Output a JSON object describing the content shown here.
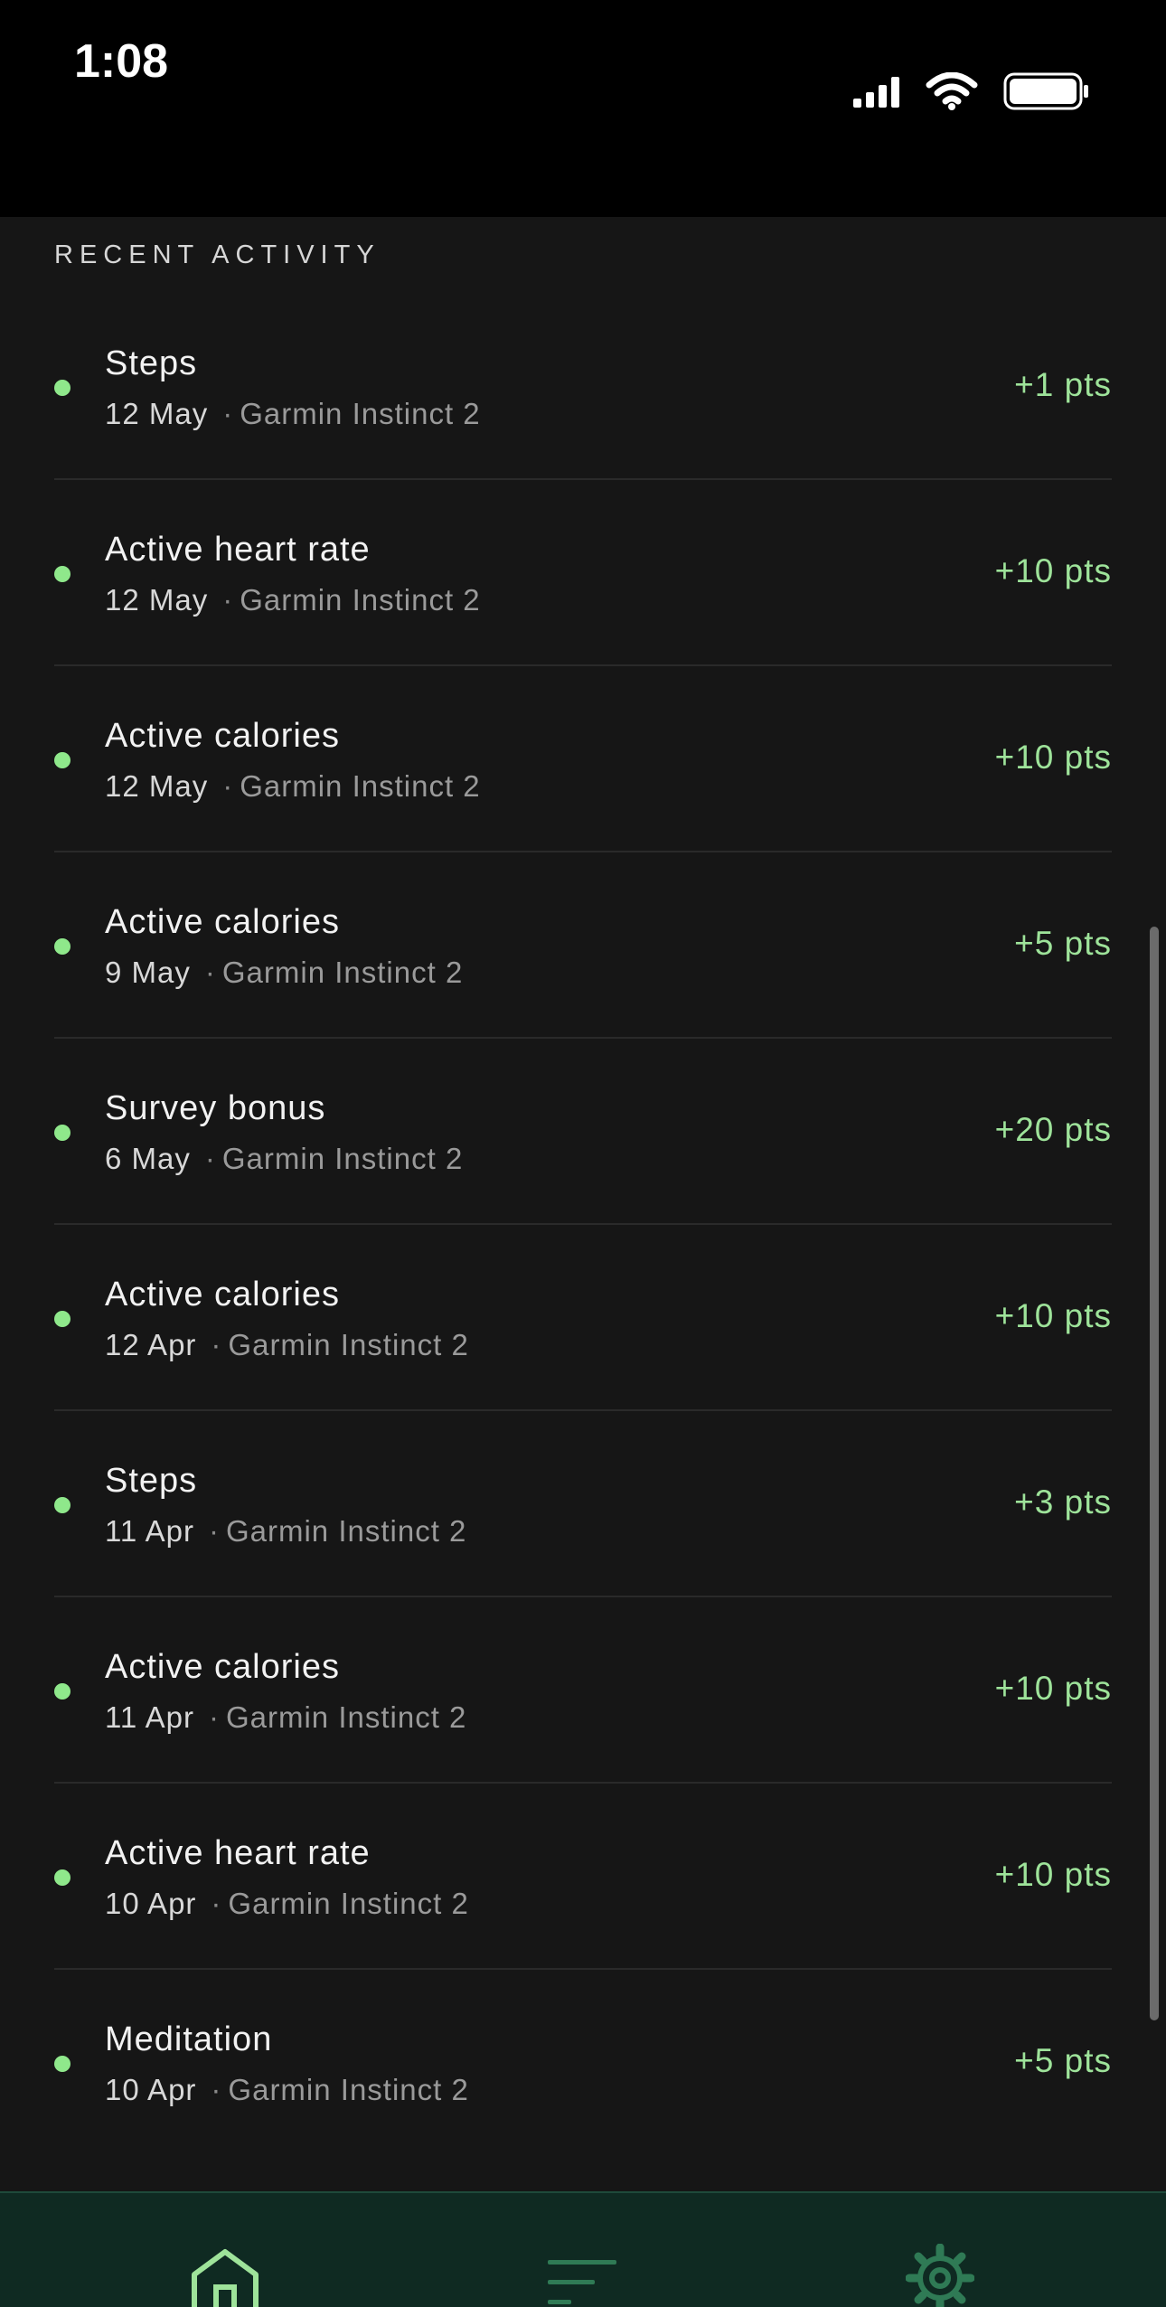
{
  "status_bar": {
    "time": "1:08",
    "icons": [
      "cellular-signal-icon",
      "wifi-icon",
      "battery-icon"
    ]
  },
  "section": {
    "title": "RECENT ACTIVITY"
  },
  "colors": {
    "accent": "#8fe88b",
    "points": "#9ee39a",
    "background": "#161616",
    "nav_background": "#0f2a22"
  },
  "activities": [
    {
      "title": "Steps",
      "date": "12 May",
      "separator": "·",
      "device": "Garmin Instinct 2",
      "points": "+1 pts"
    },
    {
      "title": "Active heart rate",
      "date": "12 May",
      "separator": "·",
      "device": "Garmin Instinct 2",
      "points": "+10 pts"
    },
    {
      "title": "Active calories",
      "date": "12 May",
      "separator": "·",
      "device": "Garmin Instinct 2",
      "points": "+10 pts"
    },
    {
      "title": "Active calories",
      "date": "9 May",
      "separator": "·",
      "device": "Garmin Instinct 2",
      "points": "+5 pts"
    },
    {
      "title": "Survey bonus",
      "date": "6 May",
      "separator": "·",
      "device": "Garmin Instinct 2",
      "points": "+20 pts"
    },
    {
      "title": "Active calories",
      "date": "12 Apr",
      "separator": "·",
      "device": "Garmin Instinct 2",
      "points": "+10 pts"
    },
    {
      "title": "Steps",
      "date": "11 Apr",
      "separator": "·",
      "device": "Garmin Instinct 2",
      "points": "+3 pts"
    },
    {
      "title": "Active calories",
      "date": "11 Apr",
      "separator": "·",
      "device": "Garmin Instinct 2",
      "points": "+10 pts"
    },
    {
      "title": "Active heart rate",
      "date": "10 Apr",
      "separator": "·",
      "device": "Garmin Instinct 2",
      "points": "+10 pts"
    },
    {
      "title": "Meditation",
      "date": "10 Apr",
      "separator": "·",
      "device": "Garmin Instinct 2",
      "points": "+5 pts"
    }
  ],
  "bottom_nav": {
    "items": [
      {
        "icon": "home-icon",
        "active": true
      },
      {
        "icon": "activity-list-icon",
        "active": false
      },
      {
        "icon": "settings-gear-icon",
        "active": false
      }
    ]
  }
}
